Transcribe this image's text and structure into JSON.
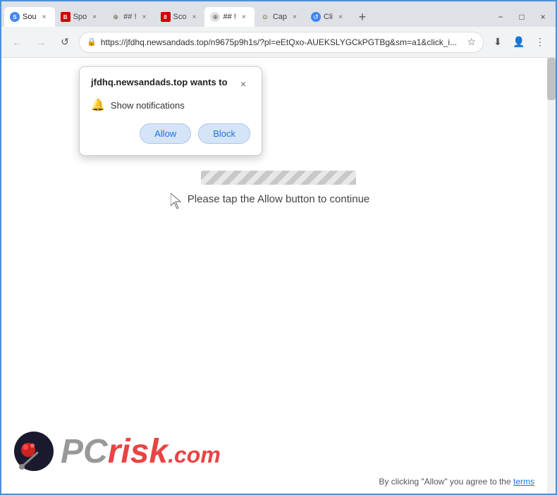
{
  "browser": {
    "tabs": [
      {
        "id": "sou",
        "label": "Sou",
        "favicon_type": "sou",
        "active": false
      },
      {
        "id": "spo",
        "label": "Spo",
        "favicon_type": "spo",
        "active": false
      },
      {
        "id": "hash1",
        "label": "## !",
        "favicon_type": "hash",
        "active": false
      },
      {
        "id": "sco",
        "label": "Sco",
        "favicon_type": "8",
        "active": false
      },
      {
        "id": "hash2",
        "label": "## !",
        "favicon_type": "glob",
        "active": true
      },
      {
        "id": "cap",
        "label": "Cap",
        "favicon_type": "cap",
        "active": false
      },
      {
        "id": "cli",
        "label": "Cli",
        "favicon_type": "cli",
        "active": false
      }
    ],
    "new_tab_label": "+",
    "address": "https://jfdhq.newsandads.top/n9675p9h1s/?pl=eEtQxo-AUEKSLYGCkPGTBg&sm=a1&click_i...",
    "nav": {
      "back_icon": "←",
      "forward_icon": "→",
      "refresh_icon": "↺"
    },
    "window_controls": {
      "minimize": "−",
      "maximize": "□",
      "close": "×"
    }
  },
  "popup": {
    "title": "jfdhq.newsandads.top wants to",
    "close_icon": "×",
    "notification_icon": "🔔",
    "notification_text": "Show notifications",
    "allow_label": "Allow",
    "block_label": "Block"
  },
  "page": {
    "instruction_text": "Please tap the Allow button to continue"
  },
  "pcrisk": {
    "pc_text": "PC",
    "risk_text": "risk",
    "dotcom_text": ".com"
  },
  "footer": {
    "disclaimer_text": "By clicking \"Allow\" you agree to the ",
    "terms_link": "terms"
  }
}
